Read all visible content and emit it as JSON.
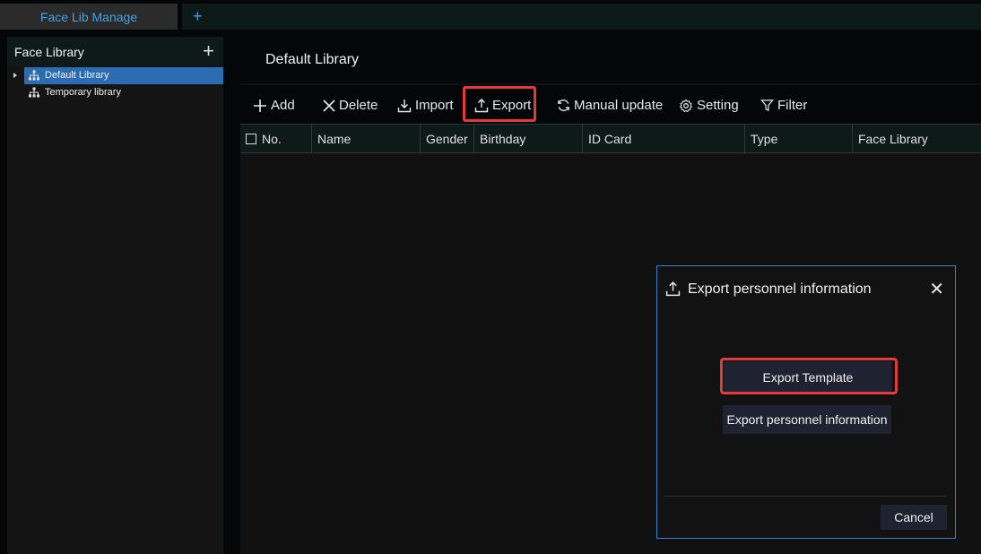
{
  "tabs": {
    "active_label": "Face Lib Manage",
    "add_label": "+"
  },
  "sidebar": {
    "title": "Face Library",
    "add_label": "+",
    "items": [
      {
        "label": "Default Library",
        "selected": true
      },
      {
        "label": "Temporary library",
        "selected": false
      }
    ]
  },
  "main": {
    "title": "Default Library",
    "toolbar": {
      "add": "Add",
      "delete": "Delete",
      "import": "Import",
      "export": "Export",
      "manual_update": "Manual update",
      "setting": "Setting",
      "filter": "Filter"
    },
    "table": {
      "columns": [
        "No.",
        "Name",
        "Gender",
        "Birthday",
        "ID Card",
        "Type",
        "Face Library"
      ]
    }
  },
  "dialog": {
    "title": "Export personnel information",
    "close_label": "✕",
    "export_template": "Export Template",
    "export_personnel": "Export personnel information",
    "cancel": "Cancel"
  },
  "colors": {
    "accent": "#3fa2e6",
    "highlight": "#e23b3b",
    "selected": "#2c6cb0",
    "dialog_border": "#3a7fc4"
  }
}
